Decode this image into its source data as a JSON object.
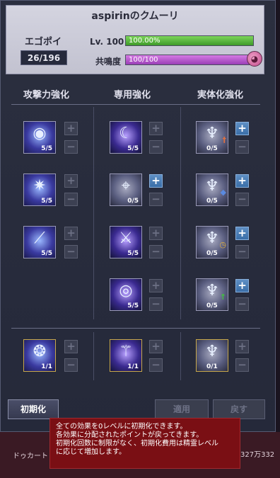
{
  "window": {
    "title": "aspirinのクムーリ",
    "ego_point_label": "エゴポイント",
    "ego_point_value": "26/196",
    "level_label": "Lv. 100",
    "level_bar_text": "100.00%",
    "level_progress": 1.0,
    "resonance_label": "共鳴度",
    "resonance_bar_text": "100/100",
    "resonance_progress": 1.0
  },
  "columns": [
    {
      "header": "攻撃力強化"
    },
    {
      "header": "専用強化"
    },
    {
      "header": "実体化強化"
    }
  ],
  "skills": {
    "attack": [
      {
        "level": "5/5",
        "icon": "blue-orb-icon"
      },
      {
        "level": "5/5",
        "icon": "star-burst-icon"
      },
      {
        "level": "5/5",
        "icon": "blade-slash-icon"
      },
      {
        "level": "1/1",
        "icon": "water-burst-icon"
      }
    ],
    "special": [
      {
        "level": "5/5",
        "icon": "crescent-slash-icon"
      },
      {
        "level": "0/5",
        "icon": "crosshair-icon"
      },
      {
        "level": "5/5",
        "icon": "crossed-swords-icon"
      },
      {
        "level": "5/5",
        "icon": "eye-icon"
      },
      {
        "level": "1/1",
        "icon": "staff-icon"
      }
    ],
    "materialize": [
      {
        "level": "0/5",
        "icon": "winged-spirit-icon",
        "badge": "sword-badge-icon"
      },
      {
        "level": "0/5",
        "icon": "winged-spirit-icon",
        "badge": "shield-badge-icon"
      },
      {
        "level": "0/5",
        "icon": "winged-spirit-icon",
        "badge": "clock-badge-icon"
      },
      {
        "level": "0/5",
        "icon": "winged-spirit-icon",
        "badge": "arrow-up-badge-icon"
      },
      {
        "level": "0/1",
        "icon": "winged-spirit-icon"
      }
    ]
  },
  "buttons": {
    "reset": "初期化",
    "apply": "適用",
    "back": "戻す"
  },
  "tooltip": {
    "lines": [
      "全ての効果を0レベルに初期化できます。",
      "各効果に分配されたポイントが戻ってきます。",
      "初期化回数に制限がなく、初期化費用は精霊レベル",
      "に応じて増加します。"
    ]
  },
  "background": {
    "left_label": "ドゥカート",
    "money": "327万332"
  },
  "colors": {
    "level_bar": "#5ebf3a",
    "resonance_bar": "#c060d8",
    "tooltip_bg": "#7a0f14",
    "plus_button": "#4a7eb8"
  }
}
